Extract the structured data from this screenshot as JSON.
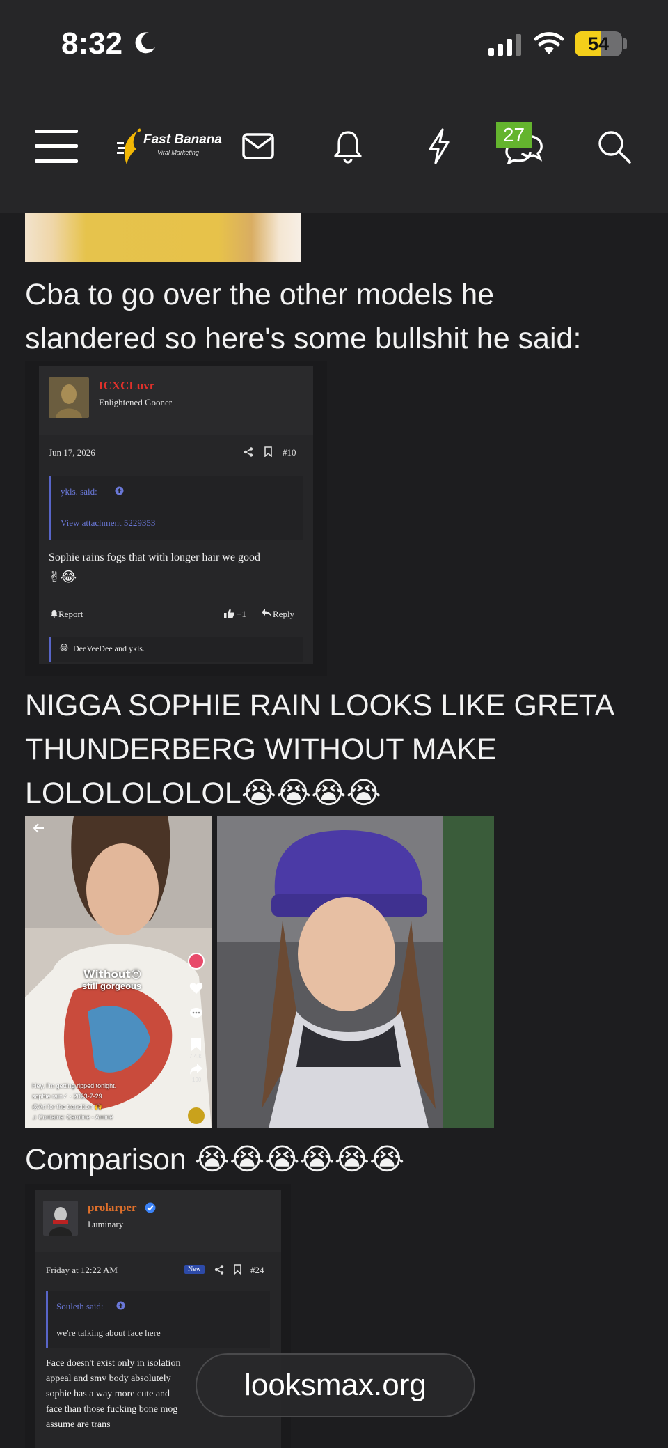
{
  "status_bar": {
    "time": "8:32",
    "battery_level": "54",
    "battery_fraction": 0.54
  },
  "nav": {
    "logo_title": "Fast Banana",
    "logo_subtitle": "Viral Marketing",
    "conversations_badge": "27"
  },
  "post": {
    "para1_line1": "Cba to go over the other models he",
    "para1_line2": "slandered so here's some bullshit he said:",
    "para2_line1": "NIGGA SOPHIE RAIN LOOKS LIKE GRETA",
    "para2_line2": "THUNDERBERG WITHOUT MAKE",
    "para2_line3": "LOLOLOLOLOL",
    "para2_emoji": "😭😭😭😭",
    "para3_text": "Comparison ",
    "para3_emoji": "😭😭😭😭😭😭"
  },
  "screenshot1": {
    "username": "ICXCLuvr",
    "user_title": "Enlightened Gooner",
    "date": "Jun 17, 2026",
    "post_number": "#10",
    "quote_author": "ykls. said:",
    "quote_attachment": "View attachment 5229353",
    "body_line1": "Sophie rains fogs that with longer hair we good",
    "body_emoji": "✌😂",
    "report_label": "Report",
    "like_count": "+1",
    "reply_label": "Reply",
    "reactions": "DeeVeeDee and ykls.",
    "colors": {
      "username": "#e0312b",
      "quote_accent": "#5865c8"
    }
  },
  "collage": {
    "caption1": "Without😍",
    "caption2": "still gorgeous",
    "footer_line1": "Hey, I'm getting ripped tonight.",
    "footer_line2": "sophie rain✓ · 2023-7-29",
    "footer_line3": "@Ari for the transition 🙌",
    "footer_line4": "♫ Contains: Caroline - Aminé",
    "likes": "7,4,k",
    "shares": "190"
  },
  "screenshot2": {
    "username": "prolarper",
    "user_title": "Luminary",
    "date": "Friday at 12:22 AM",
    "new_badge": "New",
    "post_number": "#24",
    "quote_author": "Souleth said:",
    "quote_text": "we're talking about face here",
    "body_line1": "Face doesn't exist only in isolation",
    "body_line2": "appeal and smv body absolutely",
    "body_line3": "sophie has a way more cute and",
    "body_line4": "face than those fucking bone mog",
    "body_line5": "assume are trans",
    "colors": {
      "username": "#e0702b",
      "verified": "#3b82f6"
    }
  },
  "footer": {
    "site": "looksmax.org"
  }
}
